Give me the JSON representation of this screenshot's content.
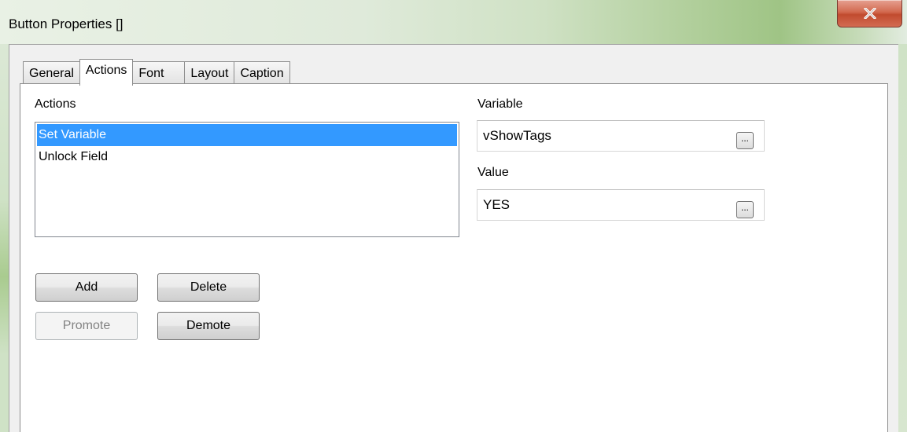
{
  "window": {
    "title": "Button Properties []",
    "close_glyph": "✕"
  },
  "tabs": [
    {
      "label": "General"
    },
    {
      "label": "Actions"
    },
    {
      "label": "Font"
    },
    {
      "label": "Layout"
    },
    {
      "label": "Caption"
    }
  ],
  "active_tab": "Actions",
  "actions": {
    "label": "Actions",
    "items": [
      "Set Variable",
      "Unlock Field"
    ],
    "selected_index": 0
  },
  "variable": {
    "label": "Variable",
    "value": "vShowTags",
    "browse_label": "..."
  },
  "value": {
    "label": "Value",
    "value": "YES",
    "browse_label": "..."
  },
  "buttons": {
    "add": "Add",
    "delete": "Delete",
    "promote": "Promote",
    "demote": "Demote"
  },
  "colors": {
    "selection": "#3399ff",
    "close_button": "#c9503a"
  }
}
